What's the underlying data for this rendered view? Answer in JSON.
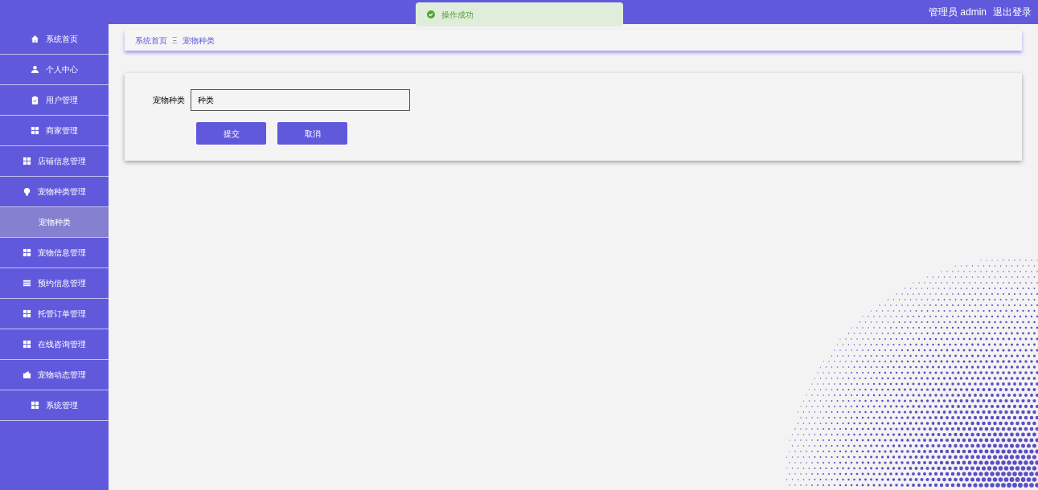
{
  "header": {
    "user_role": "管理员",
    "username": "admin",
    "logout": "退出登录"
  },
  "toast": {
    "message": "操作成功"
  },
  "sidebar": {
    "items": [
      {
        "label": "系统首页",
        "selected": false,
        "kind": "menu"
      },
      {
        "label": "个人中心",
        "selected": false,
        "kind": "menu"
      },
      {
        "label": "用户管理",
        "selected": false,
        "kind": "menu"
      },
      {
        "label": "商家管理",
        "selected": false,
        "kind": "menu"
      },
      {
        "label": "店铺信息管理",
        "selected": false,
        "kind": "menu"
      },
      {
        "label": "宠物种类管理",
        "selected": false,
        "kind": "menu"
      },
      {
        "label": "宠物种类",
        "selected": true,
        "kind": "submenu"
      },
      {
        "label": "宠物信息管理",
        "selected": false,
        "kind": "menu"
      },
      {
        "label": "预约信息管理",
        "selected": false,
        "kind": "menu"
      },
      {
        "label": "托管订单管理",
        "selected": false,
        "kind": "menu"
      },
      {
        "label": "在线咨询管理",
        "selected": false,
        "kind": "menu"
      },
      {
        "label": "宠物动态管理",
        "selected": false,
        "kind": "menu"
      },
      {
        "label": "系统管理",
        "selected": false,
        "kind": "menu"
      }
    ]
  },
  "breadcrumb": {
    "items": [
      "系统首页",
      "宠物种类"
    ],
    "separator": "Ξ"
  },
  "form": {
    "fields": [
      {
        "label": "宠物种类",
        "value": "种类"
      }
    ],
    "buttons": [
      "提交",
      "取消"
    ]
  }
}
